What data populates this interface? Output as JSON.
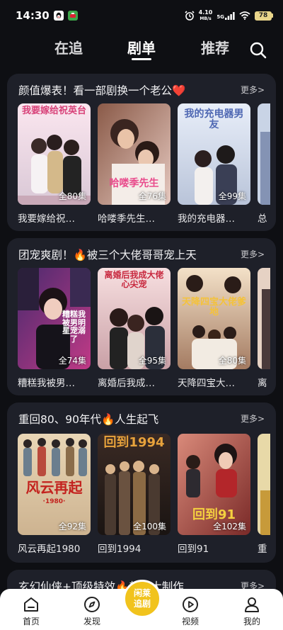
{
  "status_bar": {
    "time": "14:30",
    "net_speed_value": "4.10",
    "net_speed_unit": "MB/s",
    "signal": "5G",
    "battery": "78"
  },
  "top_tabs": [
    {
      "label": "在追",
      "active": false
    },
    {
      "label": "剧单",
      "active": true
    },
    {
      "label": "推荐",
      "active": false
    }
  ],
  "sections": [
    {
      "title": "颜值爆表！看一部剧换一个老公❤️",
      "more": "更多>",
      "cards": [
        {
          "name": "我要嫁给祝…",
          "episodes": "全80集",
          "art": "我要嫁给祝英台"
        },
        {
          "name": "哈喽季先生…",
          "episodes": "全76集",
          "art": "哈喽季先生"
        },
        {
          "name": "我的充电器…",
          "episodes": "全99集",
          "art": "我的充电器男友"
        },
        {
          "name": "总"
        }
      ]
    },
    {
      "title": "团宠爽剧！🔥被三个大佬哥哥宠上天",
      "more": "更多>",
      "cards": [
        {
          "name": "糟糕我被男…",
          "episodes": "全74集",
          "art": "糟糕我被男明星宠溺了"
        },
        {
          "name": "离婚后我成…",
          "episodes": "全95集",
          "art": "离婚后我成大佬心尖宠"
        },
        {
          "name": "天降四宝大…",
          "episodes": "全80集",
          "art": "天降四宝大佬爹地"
        },
        {
          "name": "离"
        }
      ]
    },
    {
      "title": "重回80、90年代🔥人生起飞",
      "more": "更多>",
      "cards": [
        {
          "name": "风云再起1980",
          "episodes": "全92集",
          "art": "风云再起",
          "art_sub": "·1980·"
        },
        {
          "name": "回到1994",
          "episodes": "全100集",
          "art": "回到1994"
        },
        {
          "name": "回到91",
          "episodes": "全102集",
          "art": "回到91"
        },
        {
          "name": "重"
        }
      ]
    },
    {
      "title": "玄幻仙侠+顶级特效🔥封神大制作",
      "more": "更多>"
    }
  ],
  "bottom_nav": [
    {
      "label": "首页",
      "icon": "home-icon"
    },
    {
      "label": "发现",
      "icon": "compass-icon"
    },
    {
      "label": "视频",
      "icon": "video-play-icon"
    },
    {
      "label": "我的",
      "icon": "profile-icon"
    }
  ],
  "center_button": {
    "label": "闲莱追剧"
  },
  "colors": {
    "background": "#0e0f13",
    "card_panel": "#1e2029",
    "accent_yellow": "#f1c31d"
  }
}
